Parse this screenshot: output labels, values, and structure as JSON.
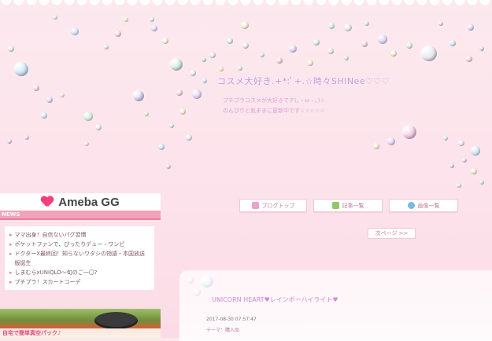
{
  "header": {
    "blog_title": "コスメ大好き.+*:ﾟ+.☆時々SHINee♡♡♡",
    "desc_line1": "プチプラコスメが大好きです(｡・ω・｡)☆",
    "desc_line2": "のんびりと気ままに更新中です☆☆☆☆☆"
  },
  "nav": {
    "top_label": "ブログトップ",
    "articles_label": "記事一覧",
    "images_label": "画像一覧",
    "next_page_label": "次ページ >>"
  },
  "sidebar": {
    "ameba_name": "Ameba GG",
    "news_label": "NEWS",
    "news_items": [
      "ママ出身！自信ないパグ習慣",
      "ポケットファンで、ぴったりデュー・ワンピ",
      "ドクターX最終回！知らないワタシの物語・本国放送版誕生",
      "しまむらxUNIQLO～旬のご一〇?",
      "プチプラ！スカートコーデ"
    ],
    "promo_text": "自宅で簡単真空パック♪"
  },
  "entry": {
    "title": "UNICORN HEART♥レインボーハイライト♥",
    "date": "2017-08-30 07:57:47",
    "theme": "テーマ：購入品"
  },
  "colors": {
    "background": "#fbe4ec",
    "accent_pink": "#f4407a",
    "title_lavender": "#c594d8"
  }
}
